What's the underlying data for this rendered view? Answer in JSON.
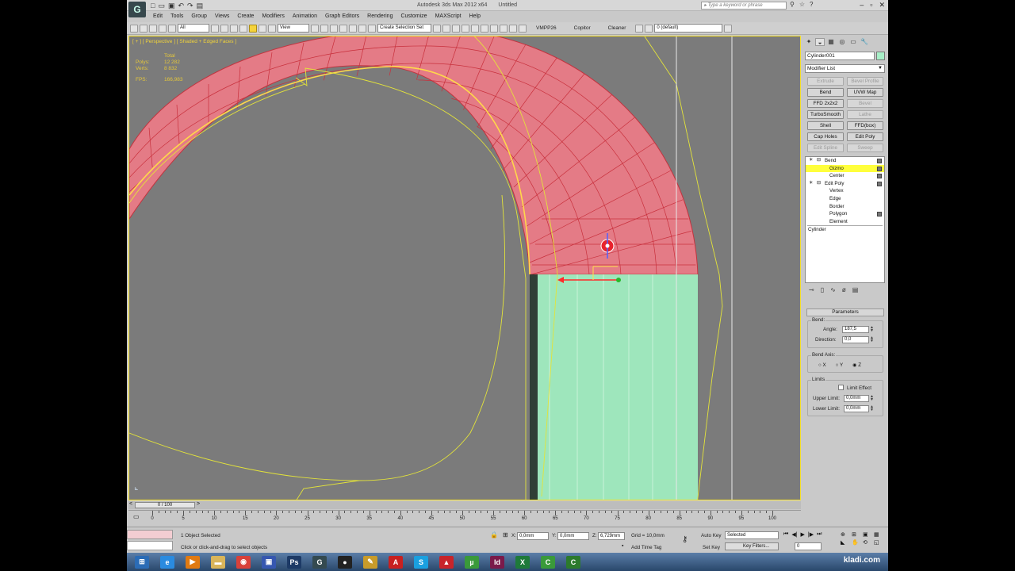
{
  "window": {
    "title": "Autodesk 3ds Max  2012 x64",
    "doc": "Untitled",
    "search_placeholder": "Type a keyword or phrase",
    "logo": "G"
  },
  "menu": [
    "Edit",
    "Tools",
    "Group",
    "Views",
    "Create",
    "Modifiers",
    "Animation",
    "Graph Editors",
    "Rendering",
    "Customize",
    "MAXScript",
    "Help"
  ],
  "toolbar": {
    "filter": "All",
    "ref_coord": "View",
    "selection_set": "Create Selection Set",
    "plugins": [
      "VMPP26",
      "Copitor",
      "Cleaner"
    ],
    "layer": "0 (default)"
  },
  "viewport": {
    "label": "[ + ] [ Perspective ] [ Shaded + Edged Faces ]",
    "stats": {
      "header": "Total",
      "polys_label": "Polys:",
      "polys": "12 282",
      "verts_label": "Verts:",
      "verts": "8 832",
      "fps_label": "FPS:",
      "fps": "166,983"
    }
  },
  "command_panel": {
    "object_name": "Cylinder001",
    "object_color": "#a8f0c8",
    "modifier_list": "Modifier List",
    "buttons": [
      {
        "label": "Extrude",
        "enabled": false
      },
      {
        "label": "Bevel Profile",
        "enabled": false
      },
      {
        "label": "Bend",
        "enabled": true
      },
      {
        "label": "UVW Map",
        "enabled": true
      },
      {
        "label": "FFD 2x2x2",
        "enabled": true
      },
      {
        "label": "Bevel",
        "enabled": false
      },
      {
        "label": "TurboSmooth",
        "enabled": true
      },
      {
        "label": "Lathe",
        "enabled": false
      },
      {
        "label": "Shell",
        "enabled": true
      },
      {
        "label": "FFD(box)",
        "enabled": true
      },
      {
        "label": "Cap Holes",
        "enabled": true
      },
      {
        "label": "Edit Poly",
        "enabled": true
      },
      {
        "label": "Edit Spline",
        "enabled": false
      },
      {
        "label": "Sweep",
        "enabled": false
      }
    ],
    "stack": [
      {
        "label": "Bend",
        "level": 0,
        "bulb": true,
        "box": true,
        "highlight": false
      },
      {
        "label": "Gizmo",
        "level": 1,
        "bulb": false,
        "box": true,
        "highlight": true
      },
      {
        "label": "Center",
        "level": 1,
        "bulb": false,
        "box": true,
        "highlight": false
      },
      {
        "label": "Edit Poly",
        "level": 0,
        "bulb": true,
        "box": true,
        "highlight": false
      },
      {
        "label": "Vertex",
        "level": 1,
        "bulb": false,
        "box": false,
        "highlight": false
      },
      {
        "label": "Edge",
        "level": 1,
        "bulb": false,
        "box": false,
        "highlight": false
      },
      {
        "label": "Border",
        "level": 1,
        "bulb": false,
        "box": false,
        "highlight": false
      },
      {
        "label": "Polygon",
        "level": 1,
        "bulb": false,
        "box": true,
        "highlight": false
      },
      {
        "label": "Element",
        "level": 1,
        "bulb": false,
        "box": false,
        "highlight": false
      },
      {
        "label": "Cylinder",
        "level": -1,
        "bulb": false,
        "box": false,
        "highlight": false
      }
    ],
    "params": {
      "title": "Parameters",
      "bend_label": "Bend:",
      "angle_label": "Angle:",
      "angle": "187,5",
      "direction_label": "Direction:",
      "direction": "0,0",
      "axis_label": "Bend Axis:",
      "axes": [
        "X",
        "Y",
        "Z"
      ],
      "axis_selected": "Z",
      "limits_label": "Limits",
      "limit_effect": "Limit Effect",
      "upper_label": "Upper Limit:",
      "upper": "0,0mm",
      "lower_label": "Lower Limit:",
      "lower": "0,0mm"
    }
  },
  "timeline": {
    "slider": "0 / 100",
    "current_frame": 0,
    "max_frame": 100,
    "ticks": [
      0,
      5,
      10,
      15,
      20,
      25,
      30,
      35,
      40,
      45,
      50,
      55,
      60,
      65,
      70,
      75,
      80,
      85,
      90,
      95,
      100
    ]
  },
  "status": {
    "selected": "1 Object Selected",
    "prompt": "Click or click-and-drag to select objects",
    "x": "0,0mm",
    "y": "0,0mm",
    "z": "6,729mm",
    "grid": "Grid = 10,0mm",
    "add_time_tag": "Add Time Tag",
    "auto_key": "Auto Key",
    "set_key": "Set Key",
    "key_mode": "Selected",
    "key_filters": "Key Filters...",
    "frame": "0"
  },
  "taskbar": {
    "brand": "kladi.com",
    "apps": [
      {
        "icon": "windows-start-icon",
        "glyph": "⊞",
        "color": "#2b6cb6"
      },
      {
        "icon": "internet-explorer-icon",
        "glyph": "e",
        "color": "#2a8be0"
      },
      {
        "icon": "media-player-icon",
        "glyph": "▶",
        "color": "#e07a12"
      },
      {
        "icon": "folder-icon",
        "glyph": "▬",
        "color": "#d9b55a"
      },
      {
        "icon": "chrome-icon",
        "glyph": "◉",
        "color": "#d8413a"
      },
      {
        "icon": "save-disk-icon",
        "glyph": "▣",
        "color": "#3657b0"
      },
      {
        "icon": "photoshop-icon",
        "glyph": "Ps",
        "color": "#1d3a66"
      },
      {
        "icon": "3dsmax-icon",
        "glyph": "G",
        "color": "#344a50"
      },
      {
        "icon": "camera-icon",
        "glyph": "●",
        "color": "#222"
      },
      {
        "icon": "pen-tool-icon",
        "glyph": "✎",
        "color": "#c89b2a"
      },
      {
        "icon": "acrobat-icon",
        "glyph": "A",
        "color": "#c82020"
      },
      {
        "icon": "skype-icon",
        "glyph": "S",
        "color": "#1aa0e0"
      },
      {
        "icon": "autocad-icon",
        "glyph": "▲",
        "color": "#c8242a"
      },
      {
        "icon": "torrent-icon",
        "glyph": "µ",
        "color": "#3a9a3a"
      },
      {
        "icon": "indesign-icon",
        "glyph": "Id",
        "color": "#7a1a4a"
      },
      {
        "icon": "excel-icon",
        "glyph": "X",
        "color": "#1e7a3a"
      },
      {
        "icon": "camtasia-icon",
        "glyph": "C",
        "color": "#3a9a3a"
      },
      {
        "icon": "camtasia-recorder-icon",
        "glyph": "C",
        "color": "#2c7a2c"
      }
    ]
  }
}
